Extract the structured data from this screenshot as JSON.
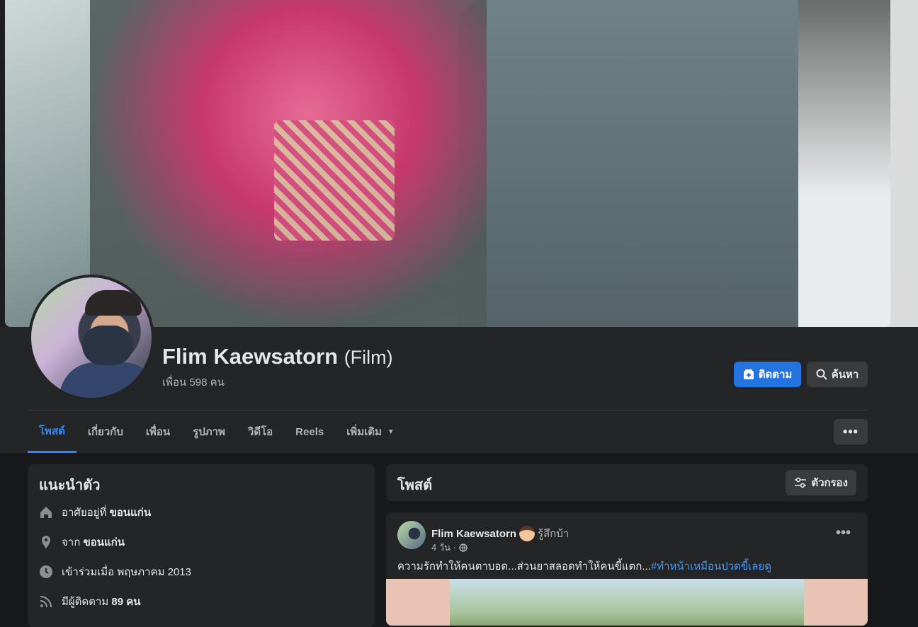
{
  "profile": {
    "name": "Flim Kaewsatorn",
    "alt_name": "(Film)",
    "friends": "เพื่อน 598 คน"
  },
  "actions": {
    "follow_label": "ติดตาม",
    "search_label": "ค้นหา"
  },
  "tabs": [
    {
      "label": "โพสต์"
    },
    {
      "label": "เกี่ยวกับ"
    },
    {
      "label": "เพื่อน"
    },
    {
      "label": "รูปภาพ"
    },
    {
      "label": "วิดีโอ"
    },
    {
      "label": "Reels"
    },
    {
      "label": "เพิ่มเติม"
    }
  ],
  "intro": {
    "title": "แนะนำตัว",
    "items": [
      {
        "icon": "home-icon",
        "prefix": "อาศัยอยู่ที่",
        "value": "ขอนแก่น"
      },
      {
        "icon": "location-pin-icon",
        "prefix": "จาก",
        "value": "ขอนแก่น"
      },
      {
        "icon": "clock-icon",
        "prefix": "เข้าร่วมเมื่อ พฤษภาคม 2013",
        "value": ""
      },
      {
        "icon": "rss-icon",
        "prefix": "มีผู้ติดตาม",
        "value": "89 คน"
      }
    ]
  },
  "posts": {
    "title": "โพสต์",
    "filter_label": "ตัวกรอง"
  },
  "post": {
    "author": "Flim Kaewsatorn",
    "feeling": "รู้สึกบ้า",
    "time": "4 วัน ·",
    "text": "ความรักทำให้คนตาบอด...ส่วนยาสลอดทำให้คนขี้แตก...",
    "hashtag": "#ทำหน้าเหมือนปวดขี้เลยดู"
  },
  "colors": {
    "accent": "#2374e1",
    "active_tab": "#2d88ff",
    "surface": "#242526",
    "background": "#18191a"
  }
}
